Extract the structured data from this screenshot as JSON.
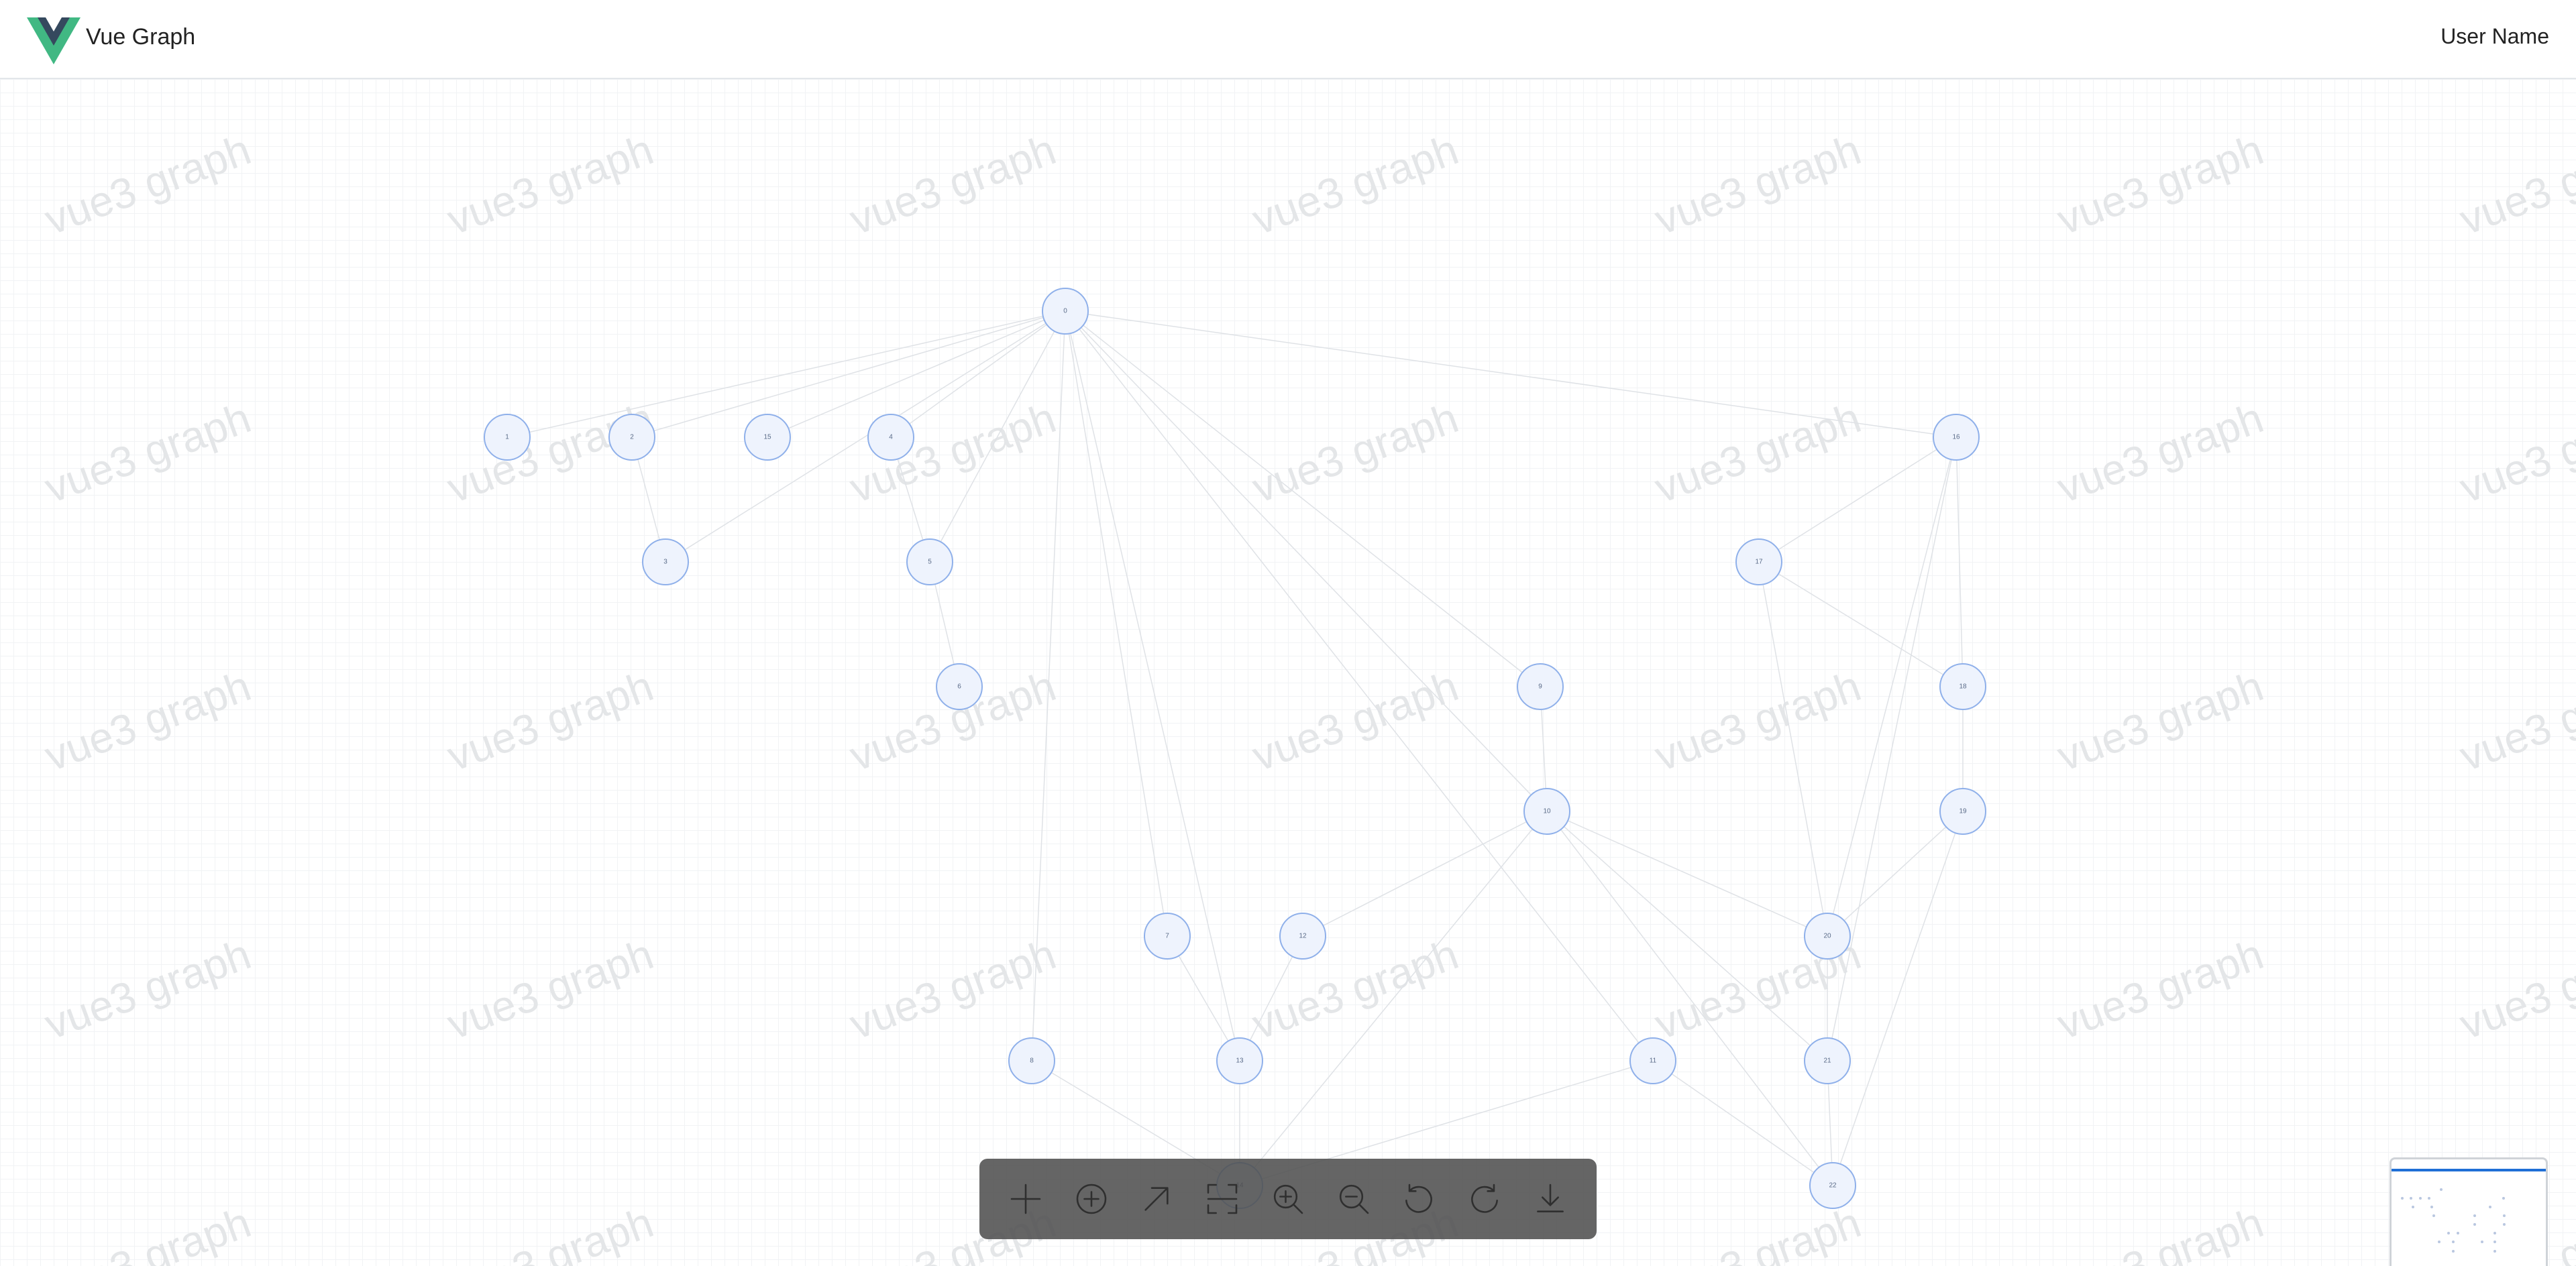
{
  "header": {
    "app_title": "Vue Graph",
    "user_name": "User Name",
    "logo_colors": {
      "outer": "#41b883",
      "inner": "#35495e"
    }
  },
  "canvas": {
    "watermark_text": "vue3 graph",
    "grid_visible": true
  },
  "graph": {
    "nodes": [
      {
        "id": "0",
        "label": "0"
      },
      {
        "id": "1",
        "label": "1"
      },
      {
        "id": "2",
        "label": "2"
      },
      {
        "id": "15",
        "label": "15"
      },
      {
        "id": "4",
        "label": "4"
      },
      {
        "id": "3",
        "label": "3"
      },
      {
        "id": "5",
        "label": "5"
      },
      {
        "id": "6",
        "label": "6"
      },
      {
        "id": "16",
        "label": "16"
      },
      {
        "id": "17",
        "label": "17"
      },
      {
        "id": "18",
        "label": "18"
      },
      {
        "id": "19",
        "label": "19"
      },
      {
        "id": "9",
        "label": "9"
      },
      {
        "id": "10",
        "label": "10"
      },
      {
        "id": "7",
        "label": "7"
      },
      {
        "id": "12",
        "label": "12"
      },
      {
        "id": "20",
        "label": "20"
      },
      {
        "id": "8",
        "label": "8"
      },
      {
        "id": "13",
        "label": "13"
      },
      {
        "id": "11",
        "label": "11"
      },
      {
        "id": "21",
        "label": "21"
      },
      {
        "id": "22",
        "label": "22"
      },
      {
        "id": "14",
        "label": "14"
      }
    ],
    "edges": [
      [
        "0",
        "1"
      ],
      [
        "0",
        "2"
      ],
      [
        "0",
        "15"
      ],
      [
        "0",
        "4"
      ],
      [
        "0",
        "3"
      ],
      [
        "0",
        "5"
      ],
      [
        "0",
        "16"
      ],
      [
        "0",
        "7"
      ],
      [
        "0",
        "8"
      ],
      [
        "0",
        "13"
      ],
      [
        "0",
        "9"
      ],
      [
        "0",
        "10"
      ],
      [
        "0",
        "11"
      ],
      [
        "2",
        "3"
      ],
      [
        "4",
        "5"
      ],
      [
        "5",
        "6"
      ],
      [
        "16",
        "17"
      ],
      [
        "16",
        "18"
      ],
      [
        "16",
        "20"
      ],
      [
        "16",
        "21"
      ],
      [
        "17",
        "18"
      ],
      [
        "17",
        "20"
      ],
      [
        "18",
        "19"
      ],
      [
        "19",
        "20"
      ],
      [
        "19",
        "22"
      ],
      [
        "9",
        "10"
      ],
      [
        "10",
        "12"
      ],
      [
        "10",
        "20"
      ],
      [
        "10",
        "21"
      ],
      [
        "10",
        "22"
      ],
      [
        "10",
        "14"
      ],
      [
        "7",
        "13"
      ],
      [
        "12",
        "13"
      ],
      [
        "20",
        "21"
      ],
      [
        "21",
        "22"
      ],
      [
        "11",
        "22"
      ],
      [
        "11",
        "14"
      ],
      [
        "8",
        "14"
      ],
      [
        "13",
        "14"
      ]
    ]
  },
  "toolbar": {
    "tools": [
      {
        "name": "add-node",
        "icon": "plus-icon",
        "label": "Add node"
      },
      {
        "name": "add-circle",
        "icon": "plus-circle-icon",
        "label": "Add circle node"
      },
      {
        "name": "add-edge",
        "icon": "arrow-up-right-icon",
        "label": "Add edge"
      },
      {
        "name": "fit-view",
        "icon": "fit-view-icon",
        "label": "Fit view"
      },
      {
        "name": "zoom-in",
        "icon": "zoom-in-icon",
        "label": "Zoom in"
      },
      {
        "name": "zoom-out",
        "icon": "zoom-out-icon",
        "label": "Zoom out"
      },
      {
        "name": "undo",
        "icon": "undo-icon",
        "label": "Undo"
      },
      {
        "name": "redo",
        "icon": "redo-icon",
        "label": "Redo"
      },
      {
        "name": "download",
        "icon": "download-icon",
        "label": "Download"
      }
    ]
  },
  "minimap": {
    "viewport_color": "#1f6fd6"
  }
}
